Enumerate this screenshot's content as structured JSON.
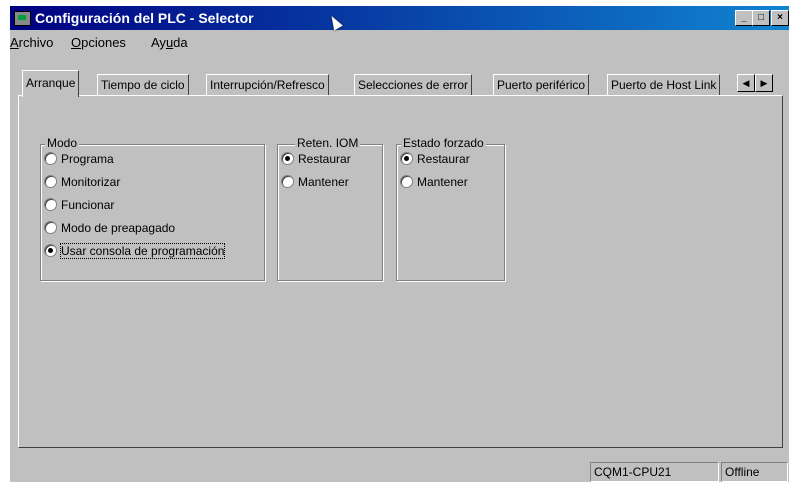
{
  "window": {
    "title": "Configuración del PLC - Selector"
  },
  "menu": {
    "archivo": "rchivo",
    "opciones": "pciones",
    "ayuda_pre": "Ay",
    "ayuda_u": "u",
    "ayuda_post": "da"
  },
  "menu_mnemonic": {
    "archivo": "A",
    "opciones": "O"
  },
  "tabs": [
    "Arranque",
    "Tiempo de ciclo",
    "Interrupción/Refresco",
    "Selecciones de error",
    "Puerto periférico",
    "Puerto de Host Link"
  ],
  "groups": {
    "modo": {
      "label": "Modo",
      "options": [
        "Programa",
        "Monitorizar",
        "Funcionar",
        "Modo de preapagado",
        "Usar consola de programación"
      ]
    },
    "reten": {
      "label": "Reten. IOM",
      "options": [
        "Restaurar",
        "Mantener"
      ]
    },
    "estado": {
      "label": "Estado forzado",
      "options": [
        "Restaurar",
        "Mantener"
      ]
    }
  },
  "status": {
    "model": "CQM1-CPU21",
    "state": "Offline"
  },
  "icons": {
    "minimize": "minimize-icon",
    "maximize": "maximize-icon",
    "close": "close-icon",
    "tab_left": "arrow-left-icon",
    "tab_right": "arrow-right-icon"
  }
}
